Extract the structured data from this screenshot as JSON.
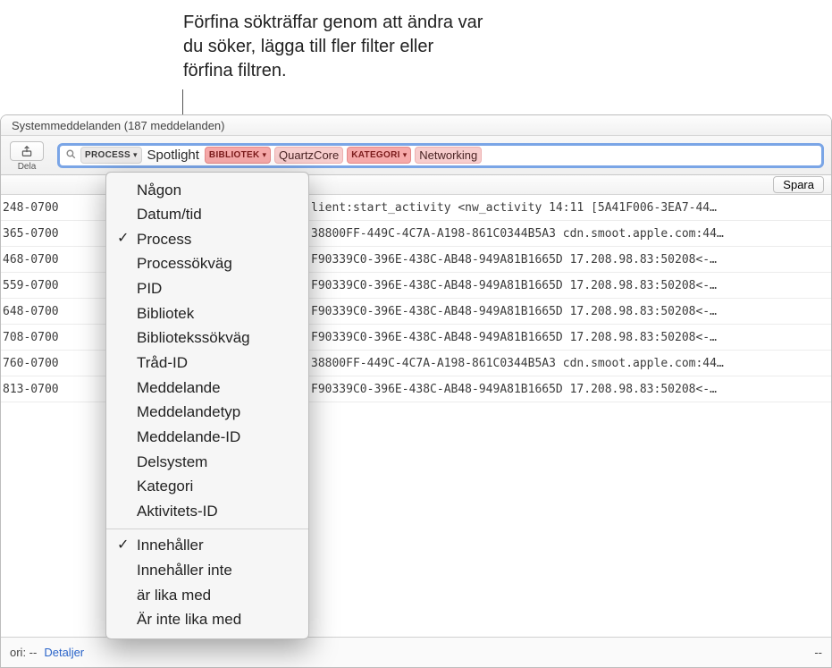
{
  "callout": "Förfina sökträffar genom att ändra var du söker, lägga till fler filter eller förfina filtren.",
  "title": "Systemmeddelanden (187 meddelanden)",
  "share": {
    "label": "Dela"
  },
  "search": {
    "tokens": {
      "process": {
        "tag": "PROCESS",
        "value": "Spotlight"
      },
      "library": {
        "tag": "BIBLIOTEK",
        "value": "QuartzCore"
      },
      "category": {
        "tag": "KATEGORI",
        "value": "Networking"
      }
    }
  },
  "saveLabel": "Spara",
  "rows": [
    {
      "ts": "248-0700",
      "msg": "lient:start_activity <nw_activity 14:11 [5A41F006-3EA7-44…"
    },
    {
      "ts": "365-0700",
      "msg": "38800FF-449C-4C7A-A198-861C0344B5A3 cdn.smoot.apple.com:44…"
    },
    {
      "ts": "468-0700",
      "msg": "F90339C0-396E-438C-AB48-949A81B1665D 17.208.98.83:50208<-…"
    },
    {
      "ts": "559-0700",
      "msg": "F90339C0-396E-438C-AB48-949A81B1665D 17.208.98.83:50208<-…"
    },
    {
      "ts": "648-0700",
      "msg": "F90339C0-396E-438C-AB48-949A81B1665D 17.208.98.83:50208<-…"
    },
    {
      "ts": "708-0700",
      "msg": "F90339C0-396E-438C-AB48-949A81B1665D 17.208.98.83:50208<-…"
    },
    {
      "ts": "760-0700",
      "msg": "38800FF-449C-4C7A-A198-861C0344B5A3 cdn.smoot.apple.com:44…"
    },
    {
      "ts": "813-0700",
      "msg": "F90339C0-396E-438C-AB48-949A81B1665D 17.208.98.83:50208<-…"
    }
  ],
  "footer": {
    "ori": "ori: --",
    "detaljer": "Detaljer",
    "dash": "--"
  },
  "dropdown": {
    "group1": [
      "Någon",
      "Datum/tid",
      "Process",
      "Processökväg",
      "PID",
      "Bibliotek",
      "Bibliotekssökväg",
      "Tråd-ID",
      "Meddelande",
      "Meddelandetyp",
      "Meddelande-ID",
      "Delsystem",
      "Kategori",
      "Aktivitets-ID"
    ],
    "selected1": "Process",
    "group2": [
      "Innehåller",
      "Innehåller inte",
      "är lika med",
      "Är inte lika med"
    ],
    "selected2": "Innehåller"
  }
}
